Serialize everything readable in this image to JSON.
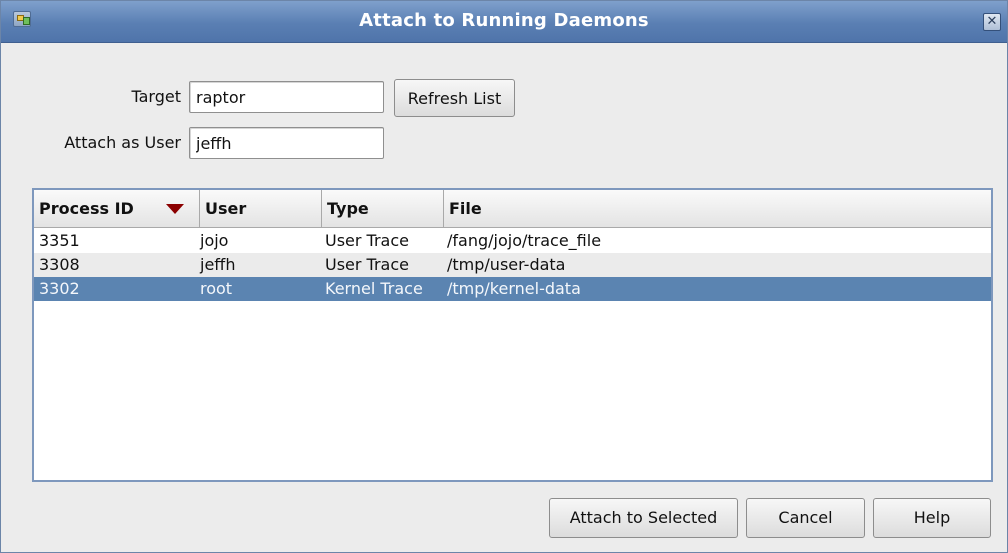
{
  "window": {
    "title": "Attach to Running Daemons",
    "close_symbol": "✕"
  },
  "form": {
    "target_label": "Target",
    "target_value": "raptor",
    "refresh_label": "Refresh List",
    "user_label": "Attach as User",
    "user_value": "jeffh"
  },
  "table": {
    "columns": [
      "Process ID",
      "User",
      "Type",
      "File"
    ],
    "sort_column": "Process ID",
    "sort_direction": "descending",
    "rows": [
      {
        "pid": "3351",
        "user": "jojo",
        "type": "User Trace",
        "file": "/fang/jojo/trace_file"
      },
      {
        "pid": "3308",
        "user": "jeffh",
        "type": "User Trace",
        "file": "/tmp/user-data"
      },
      {
        "pid": "3302",
        "user": "root",
        "type": "Kernel Trace",
        "file": "/tmp/kernel-data"
      }
    ],
    "selected_row": 2
  },
  "footer": {
    "attach_label": "Attach to Selected",
    "cancel_label": "Cancel",
    "help_label": "Help"
  },
  "colors": {
    "titlebar": "#5a7fb3",
    "selection": "#5b84b1",
    "sort_arrow": "#8b0000"
  }
}
